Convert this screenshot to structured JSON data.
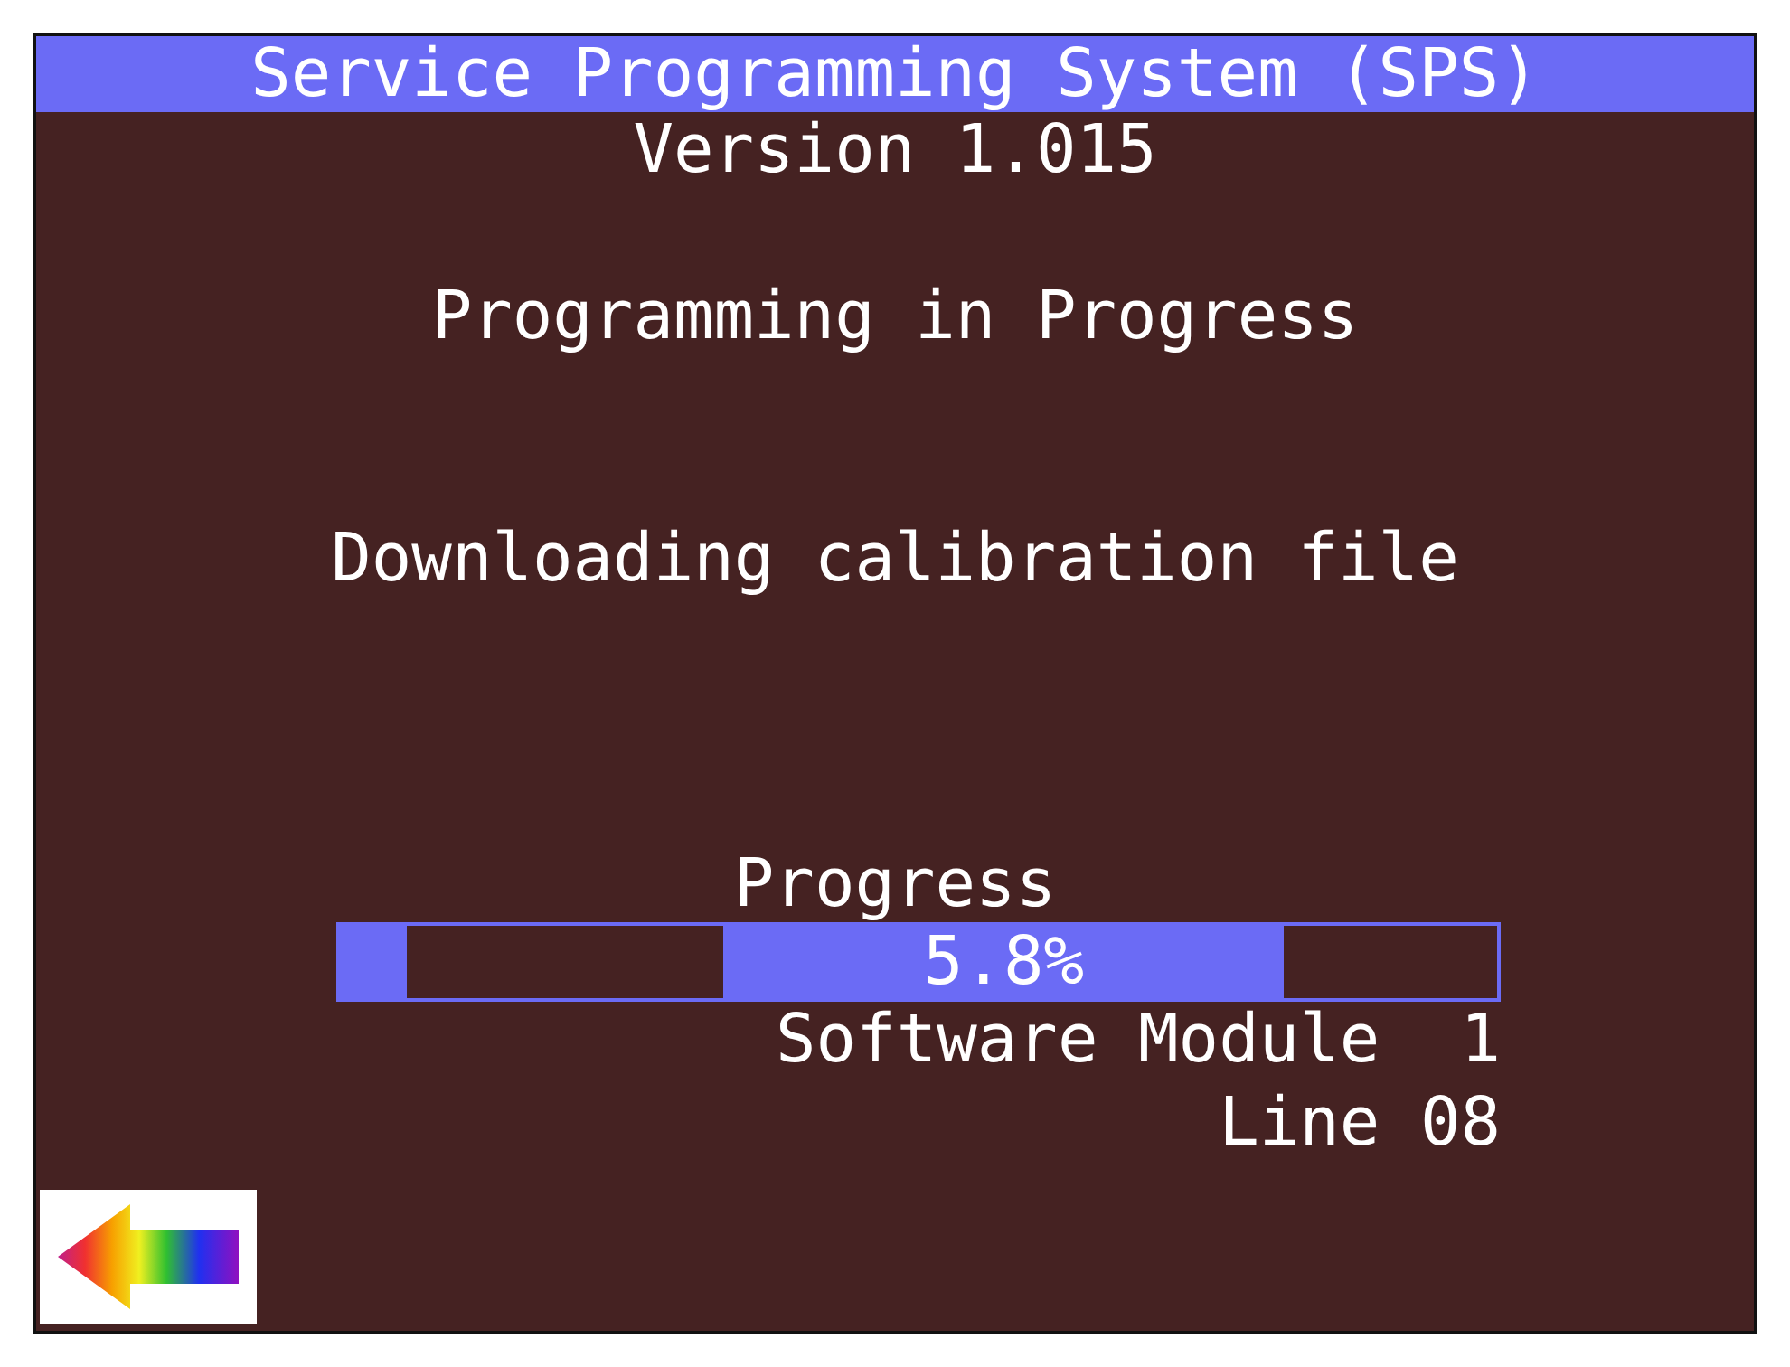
{
  "title_bar": {
    "title": "Service Programming System (SPS)"
  },
  "version": "Version 1.015",
  "status": "Programming in Progress",
  "activity": "Downloading calibration file",
  "progress": {
    "label": "Progress",
    "level": 0.058,
    "reading": "5.8%"
  },
  "module": "Software Module  1",
  "line": "Line 08"
}
